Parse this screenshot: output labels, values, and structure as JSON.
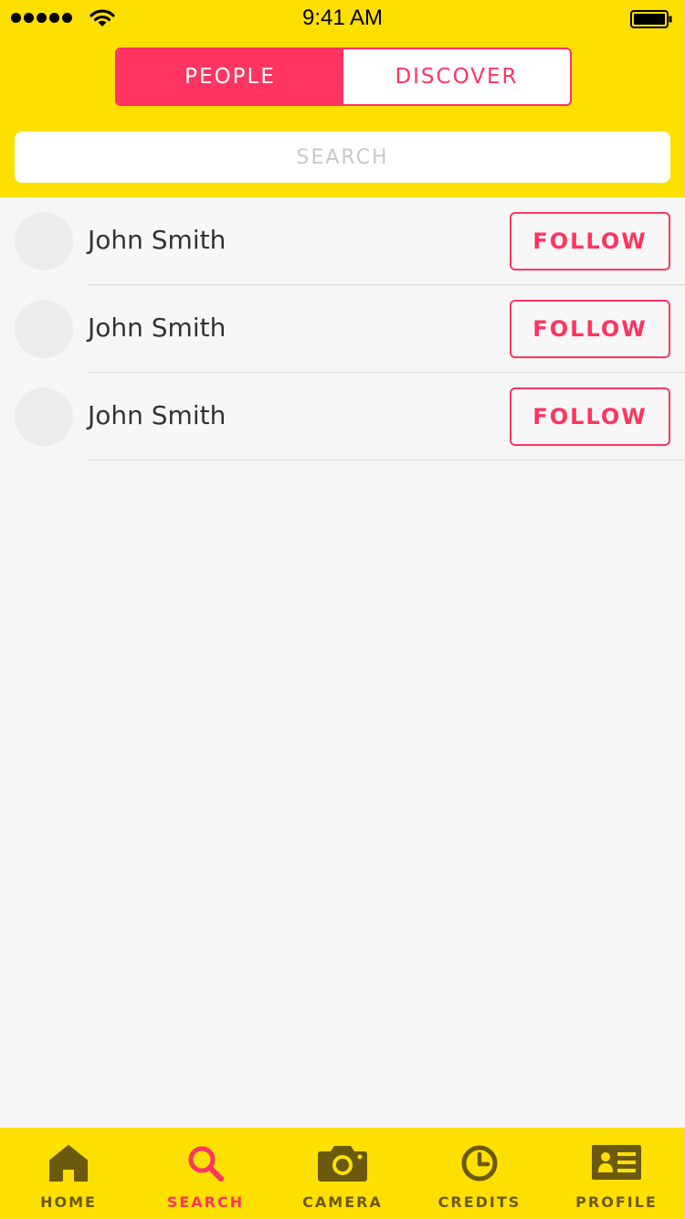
{
  "status_bar": {
    "time": "9:41 AM"
  },
  "segmented": {
    "people_label": "PEOPLE",
    "discover_label": "DISCOVER",
    "selected": "PEOPLE"
  },
  "search": {
    "placeholder": "SEARCH",
    "value": ""
  },
  "people": [
    {
      "name": "John Smith",
      "action_label": "FOLLOW"
    },
    {
      "name": "John Smith",
      "action_label": "FOLLOW"
    },
    {
      "name": "John Smith",
      "action_label": "FOLLOW"
    }
  ],
  "tabbar": {
    "items": [
      {
        "label": "HOME",
        "icon": "home-icon"
      },
      {
        "label": "SEARCH",
        "icon": "search-icon"
      },
      {
        "label": "CAMERA",
        "icon": "camera-icon"
      },
      {
        "label": "CREDITS",
        "icon": "clock-icon"
      },
      {
        "label": "PROFILE",
        "icon": "id-card-icon"
      }
    ],
    "active": "SEARCH"
  },
  "colors": {
    "brand_yellow": "#fee000",
    "accent_pink": "#ff3461",
    "tab_inactive": "#6b5a0e",
    "background": "#f7f7f7"
  }
}
